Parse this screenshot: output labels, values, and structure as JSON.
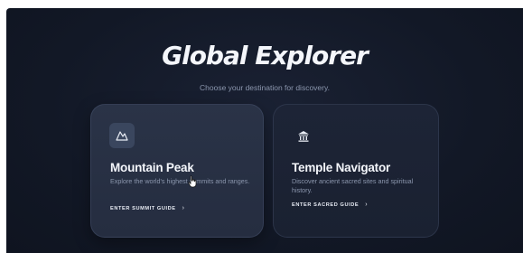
{
  "hero": {
    "title": "Global Explorer",
    "subtitle": "Choose your destination for discovery."
  },
  "cards": [
    {
      "icon": "mountain-icon",
      "title": "Mountain Peak",
      "description": "Explore the world's highest summits and ranges.",
      "link_label": "ENTER SUMMIT GUIDE",
      "link_chevron": "›"
    },
    {
      "icon": "temple-icon",
      "title": "Temple Navigator",
      "description": "Discover ancient sacred sites and spiritual history.",
      "link_label": "ENTER SACRED GUIDE",
      "link_chevron": "›"
    }
  ],
  "colors": {
    "background": "#121826",
    "card_hover": "#2a3347",
    "card": "#1d2436",
    "text_primary": "#f4f6fb",
    "text_muted": "#8b96ad"
  }
}
